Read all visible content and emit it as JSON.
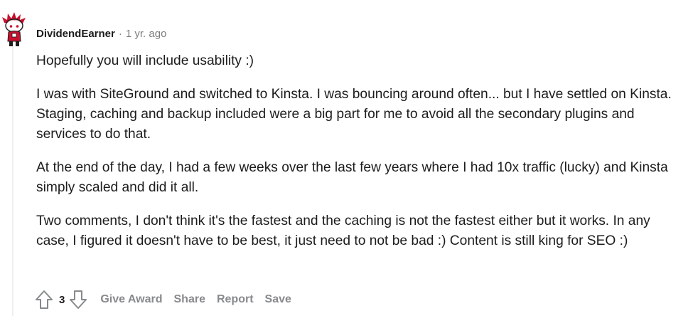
{
  "comment": {
    "author": "DividendEarner",
    "separator": "·",
    "time_ago": "1 yr. ago",
    "paragraphs": [
      "Hopefully you will include usability :)",
      "I was with SiteGround and switched to Kinsta. I was bouncing around often... but I have settled on Kinsta. Staging, caching and backup included were a big part for me to avoid all the secondary plugins and services to do that.",
      "At the end of the day, I had a few weeks over the last few years where I had 10x traffic (lucky) and Kinsta simply scaled and did it all.",
      "Two comments, I don't think it's the fastest and the caching is not the fastest either but it works. In any case, I figured it doesn't have to be best, it just need to not be bad :) Content is still king for SEO :)"
    ],
    "score": "3",
    "actions": {
      "give_award": "Give Award",
      "share": "Share",
      "report": "Report",
      "save": "Save"
    }
  },
  "icons": {
    "avatar": "snoo-avatar",
    "upvote": "upvote-arrow-icon",
    "downvote": "downvote-arrow-icon"
  },
  "colors": {
    "text_primary": "#1c1c1c",
    "text_muted": "#7c7c7c",
    "action_gray": "#878a8c",
    "avatar_red": "#c8102e",
    "thread_line": "#edeff1"
  }
}
